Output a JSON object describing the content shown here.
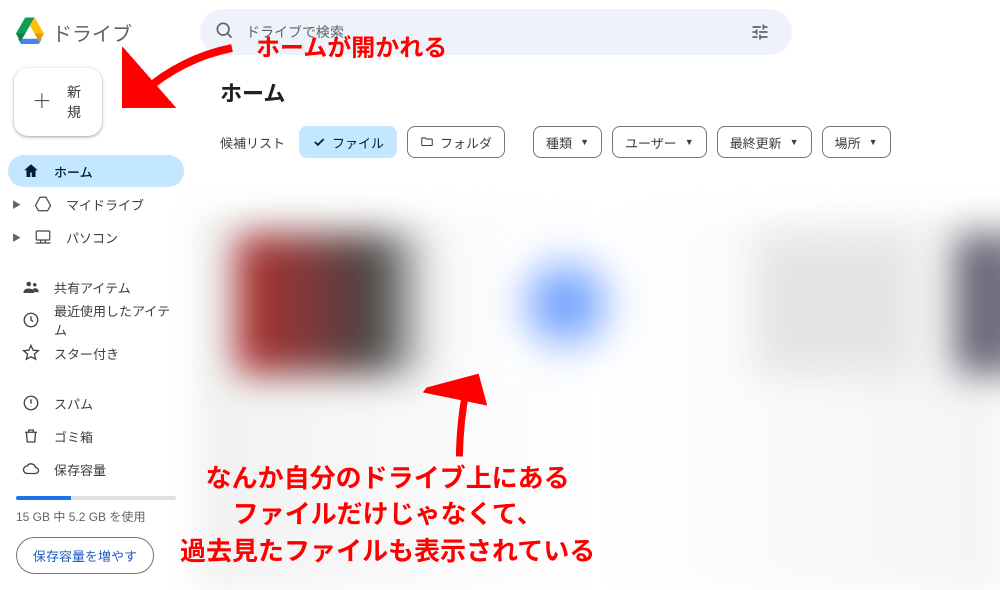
{
  "app": {
    "name": "ドライブ"
  },
  "search": {
    "placeholder": "ドライブで検索"
  },
  "new_button": {
    "label": "新規"
  },
  "sidebar": {
    "items": [
      {
        "label": "ホーム"
      },
      {
        "label": "マイドライブ"
      },
      {
        "label": "パソコン"
      },
      {
        "label": "共有アイテム"
      },
      {
        "label": "最近使用したアイテム"
      },
      {
        "label": "スター付き"
      },
      {
        "label": "スパム"
      },
      {
        "label": "ゴミ箱"
      },
      {
        "label": "保存容量"
      }
    ]
  },
  "storage": {
    "used_label": "15 GB 中 5.2 GB を使用",
    "cta": "保存容量を増やす"
  },
  "main": {
    "title": "ホーム",
    "filter_label": "候補リスト",
    "chips": {
      "file": "ファイル",
      "folder": "フォルダ",
      "type": "種類",
      "user": "ユーザー",
      "modified": "最終更新",
      "location": "場所"
    }
  },
  "annotations": {
    "top": "ホームが開かれる",
    "bottom_l1": "なんか自分のドライブ上にある",
    "bottom_l2": "ファイルだけじゃなくて、",
    "bottom_l3": "過去見たファイルも表示されている"
  }
}
